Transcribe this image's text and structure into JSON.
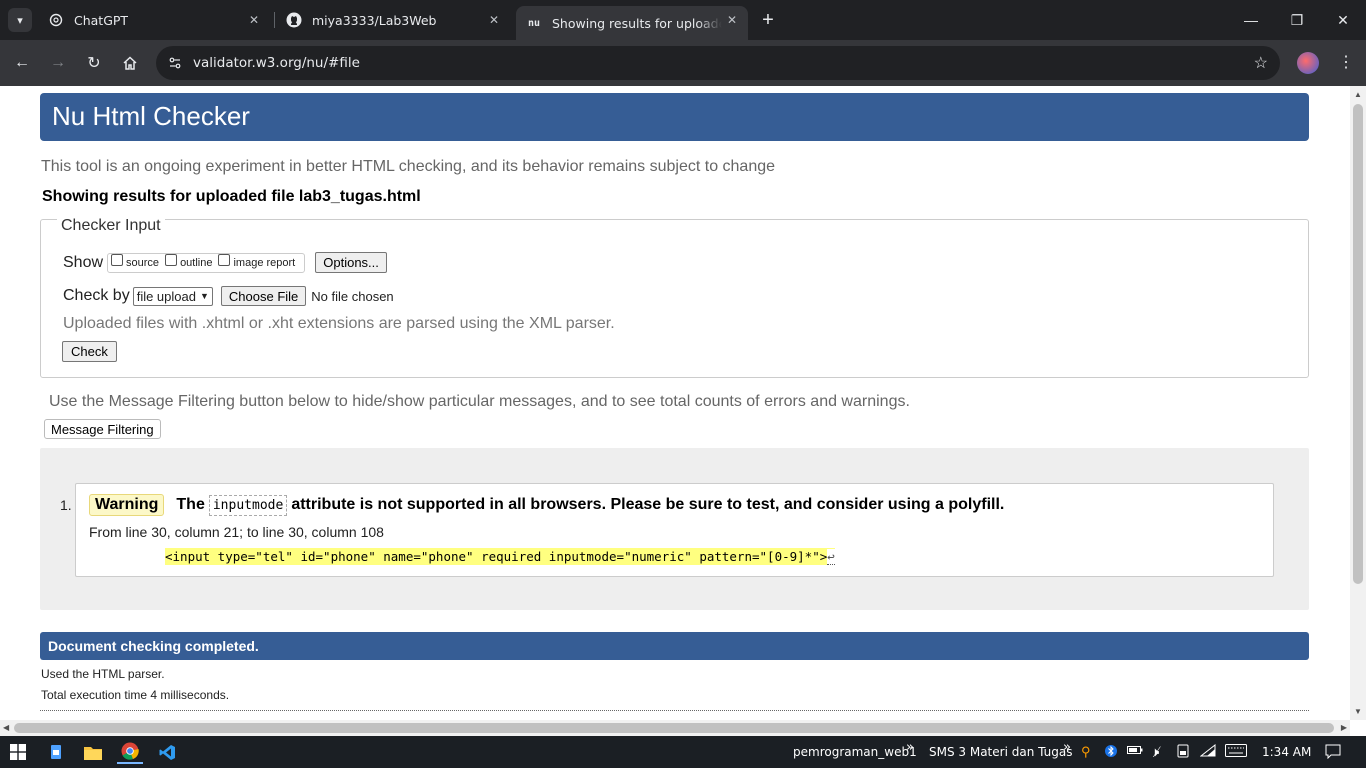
{
  "browser": {
    "tabs": [
      {
        "title": "ChatGPT",
        "icon": "chatgpt-icon",
        "active": false
      },
      {
        "title": "miya3333/Lab3Web",
        "icon": "github-icon",
        "active": false
      },
      {
        "title": "Showing results for uploaded file",
        "icon": "nu-icon",
        "active": true
      }
    ],
    "new_tab": "+",
    "url": "validator.w3.org/nu/#file",
    "active_favicon_text": "nu"
  },
  "page": {
    "banner_title": "Nu Html Checker",
    "subtitle": "This tool is an ongoing experiment in better HTML checking, and its behavior remains subject to change",
    "results_heading": "Showing results for uploaded file lab3_tugas.html",
    "checker_input": {
      "legend": "Checker Input",
      "show_label": "Show",
      "show_options": [
        "source",
        "outline",
        "image report"
      ],
      "options_button": "Options...",
      "check_by_label": "Check by",
      "check_by_value": "file upload",
      "choose_file_button": "Choose File",
      "no_file_text": "No file chosen",
      "hint": "Uploaded files with .xhtml or .xht extensions are parsed using the XML parser.",
      "check_button": "Check"
    },
    "filter_note": "Use the Message Filtering button below to hide/show particular messages, and to see total counts of errors and warnings.",
    "filter_button": "Message Filtering",
    "messages": [
      {
        "number": "1.",
        "type": "Warning",
        "text_before": "The",
        "code": "inputmode",
        "text_after": "attribute is not supported in all browsers. Please be sure to test, and consider using a polyfill.",
        "location": "From line 30, column 21; to line 30, column 108",
        "extract": "<input type=\"tel\" id=\"phone\" name=\"phone\" required inputmode=\"numeric\" pattern=\"[0-9]*\">",
        "linebreak": "↩"
      }
    ],
    "done": "Document checking completed.",
    "parser_note": "Used the HTML parser.",
    "exec_note": "Total execution time 4 milliseconds."
  },
  "taskbar": {
    "items": [
      "windows-start-icon",
      "file-explorer-icon",
      "folder-icon",
      "chrome-icon",
      "vscode-icon"
    ],
    "toolbar_1": "pemrograman_web1",
    "toolbar_2": "SMS 3 Materi dan Tugas",
    "chevron": "»",
    "time": "1:34 AM"
  },
  "colors": {
    "banner": "#365d95",
    "warning_badge": "#fcf8c8",
    "extract_highlight": "#ffff80"
  }
}
